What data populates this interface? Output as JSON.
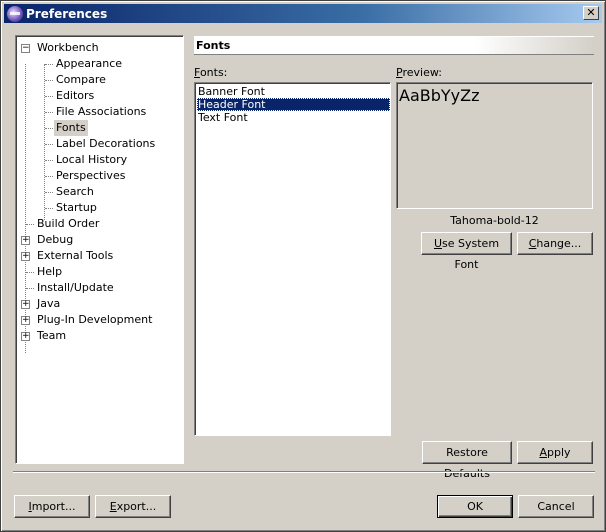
{
  "window": {
    "title": "Preferences",
    "close_symbol": "✕"
  },
  "tree": {
    "items": [
      {
        "label": "Workbench",
        "expander": "−"
      },
      {
        "label": "Appearance"
      },
      {
        "label": "Compare"
      },
      {
        "label": "Editors"
      },
      {
        "label": "File Associations"
      },
      {
        "label": "Fonts"
      },
      {
        "label": "Label Decorations"
      },
      {
        "label": "Local History"
      },
      {
        "label": "Perspectives"
      },
      {
        "label": "Search"
      },
      {
        "label": "Startup"
      },
      {
        "label": "Build Order"
      },
      {
        "label": "Debug",
        "expander": "+"
      },
      {
        "label": "External Tools",
        "expander": "+"
      },
      {
        "label": "Help"
      },
      {
        "label": "Install/Update"
      },
      {
        "label": "Java",
        "expander": "+"
      },
      {
        "label": "Plug-In Development",
        "expander": "+"
      },
      {
        "label": "Team",
        "expander": "+"
      }
    ]
  },
  "page": {
    "title": "Fonts",
    "fonts_label": "Fonts:",
    "fonts_list": [
      "Banner Font",
      "Header Font",
      "Text Font"
    ],
    "preview_label": "Preview:",
    "preview_text": "AaBbYyZz",
    "font_description": "Tahoma-bold-12"
  },
  "buttons": {
    "use_system_font": "Use System Font",
    "change": "Change...",
    "restore_defaults": "Restore Defaults",
    "apply": "Apply",
    "import": "Import...",
    "export": "Export...",
    "ok": "OK",
    "cancel": "Cancel"
  },
  "colors": {
    "selection": "#0a246a",
    "titlebar": "#0a246a",
    "face": "#d4d0c8"
  },
  "icons": {
    "app": "eclipse-icon",
    "close": "close-icon"
  }
}
